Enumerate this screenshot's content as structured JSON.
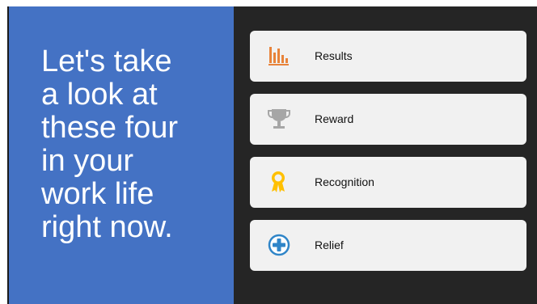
{
  "colors": {
    "left_panel": "#4472c4",
    "background": "#252525",
    "card": "#f1f1f1",
    "results_icon": "#e8833a",
    "reward_icon": "#a6a6a6",
    "recognition_icon": "#ffc000",
    "relief_icon": "#2f85c8"
  },
  "headline": {
    "lines": [
      "Let's take",
      "a look at",
      "these four",
      "in your",
      "work life",
      "right now."
    ]
  },
  "cards": [
    {
      "label": "Results",
      "icon": "bar-chart-icon"
    },
    {
      "label": "Reward",
      "icon": "trophy-icon"
    },
    {
      "label": "Recognition",
      "icon": "award-ribbon-icon"
    },
    {
      "label": "Relief",
      "icon": "plus-circle-icon"
    }
  ]
}
